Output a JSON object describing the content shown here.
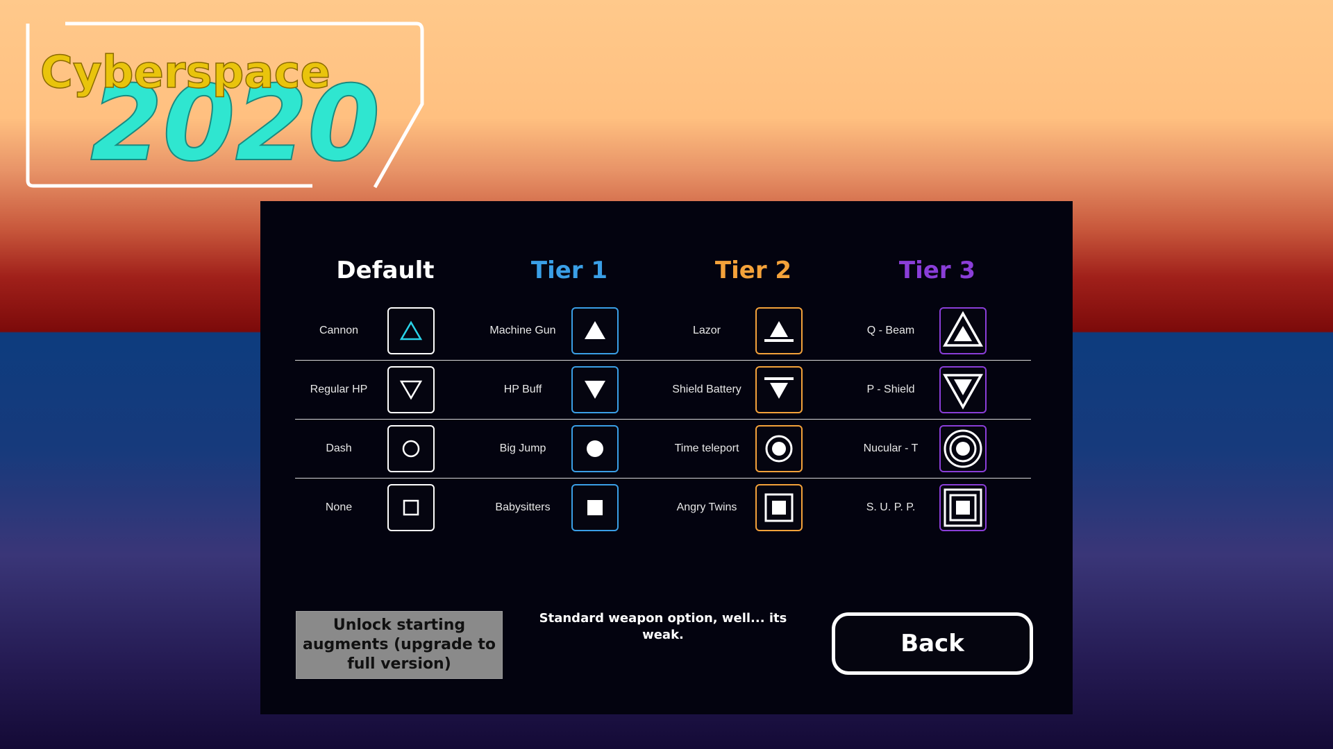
{
  "logo": {
    "line1": "Cyberspace",
    "line2": "2020",
    "line1_color": "#e9c40c",
    "line2_color": "#2fe6d0"
  },
  "columns": [
    {
      "title": "Default",
      "color": "#ffffff",
      "border": "#ffffff",
      "items": [
        {
          "label": "Cannon",
          "icon": "triangle-up-outline-icon"
        },
        {
          "label": "Regular HP",
          "icon": "triangle-down-outline-icon"
        },
        {
          "label": "Dash",
          "icon": "circle-outline-icon"
        },
        {
          "label": "None",
          "icon": "square-outline-icon"
        }
      ]
    },
    {
      "title": "Tier 1",
      "color": "#3a9fe6",
      "border": "#3a9fe6",
      "items": [
        {
          "label": "Machine Gun",
          "icon": "triangle-up-filled-icon"
        },
        {
          "label": "HP Buff",
          "icon": "triangle-down-filled-icon"
        },
        {
          "label": "Big Jump",
          "icon": "circle-filled-icon"
        },
        {
          "label": "Babysitters",
          "icon": "square-filled-icon"
        }
      ]
    },
    {
      "title": "Tier 2",
      "color": "#f4a23a",
      "border": "#f4a23a",
      "items": [
        {
          "label": "Lazor",
          "icon": "triangle-up-base-icon"
        },
        {
          "label": "Shield Battery",
          "icon": "triangle-down-bar-icon"
        },
        {
          "label": "Time teleport",
          "icon": "circle-ringed-icon"
        },
        {
          "label": "Angry Twins",
          "icon": "square-framed-icon"
        }
      ]
    },
    {
      "title": "Tier 3",
      "color": "#8a3ed8",
      "border": "#8a3ed8",
      "items": [
        {
          "label": "Q - Beam",
          "icon": "triangle-up-double-icon"
        },
        {
          "label": "P - Shield",
          "icon": "triangle-down-double-icon"
        },
        {
          "label": "Nucular - T",
          "icon": "circle-double-ring-icon"
        },
        {
          "label": "S. U. P. P.",
          "icon": "square-double-frame-icon"
        }
      ]
    }
  ],
  "unlock_button": {
    "label": "Unlock starting augments (upgrade to full version)"
  },
  "description": "Standard weapon option, well... its weak.",
  "back_button": {
    "label": "Back"
  },
  "accent": {
    "cannon_icon": "#2ad3e8"
  }
}
